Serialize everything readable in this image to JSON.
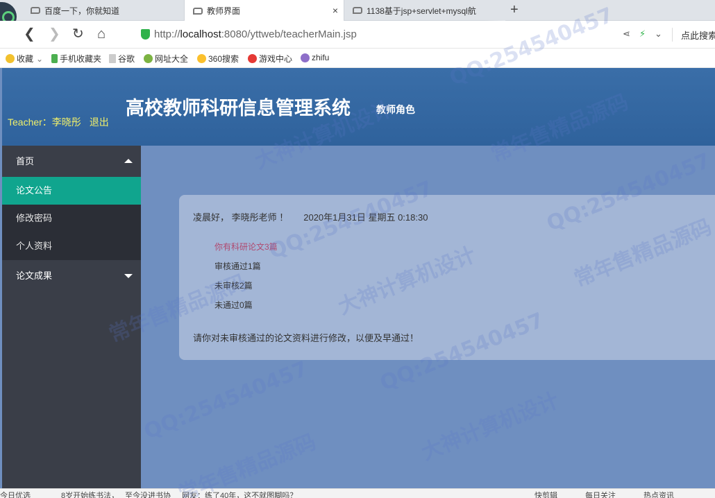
{
  "browser": {
    "tabs": [
      {
        "title": "百度一下，你就知道",
        "active": false
      },
      {
        "title": "教师界面",
        "active": true
      },
      {
        "title": "1138基于jsp+servlet+mysql航",
        "active": false
      }
    ],
    "close_glyph": "×",
    "new_tab_glyph": "+",
    "url_prefix": "http://",
    "url_host": "localhost",
    "url_rest": ":8080/yttweb/teacherMain.jsp",
    "search_hint": "点此搜索",
    "bookmarks": [
      "收藏",
      "手机收藏夹",
      "谷歌",
      "网址大全",
      "360搜索",
      "游戏中心",
      "zhifu"
    ]
  },
  "header": {
    "user_label": "Teacher：李晓彤",
    "logout_label": "退出",
    "system_title": "高校教师科研信息管理系统",
    "role_label": "教师角色"
  },
  "sidebar": {
    "group_home": "首页",
    "items": [
      "论文公告",
      "修改密码",
      "个人资料"
    ],
    "group_results": "论文成果"
  },
  "main": {
    "greeting": "凌晨好， 李晓彤老师 ！",
    "datetime": "2020年1月31日 星期五 0:18:30",
    "stats": [
      "你有科研论文3篇",
      "审核通过1篇",
      "未审核2篇",
      "未通过0篇"
    ],
    "notice": "请你对未审核通过的论文资料进行修改，以便及早通过！"
  },
  "watermarks": [
    "QQ:254540457",
    "常年售精品源码",
    "大神计算机设计",
    "QQ:254540457",
    "常年售精品源码",
    "大神计算机设计",
    "QQ:254540457",
    "常年售精品源码",
    "QQ:254540457",
    "大神计算机设计",
    "常年售精品源码",
    "QQ:254540457"
  ],
  "statusbar": {
    "left": "今日优选",
    "news1": "8岁开始练书法，",
    "news2": "至今没进书协",
    "news3": "网友：练了40年，这不就图糊吗？",
    "right1": "快剪辑",
    "right2": "每日关注",
    "right3": "热点资讯"
  },
  "colors": {
    "header_bg": "#2f629c",
    "page_bg": "#6f8fc0",
    "sidebar_bg": "#3a3e48",
    "active_item": "#10a58e",
    "user_text": "#f1f06a"
  }
}
